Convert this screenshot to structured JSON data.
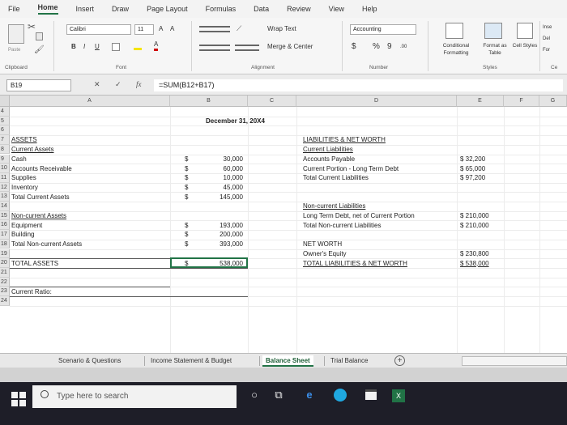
{
  "menu": {
    "tabs": [
      "File",
      "Home",
      "Insert",
      "Draw",
      "Page Layout",
      "Formulas",
      "Data",
      "Review",
      "View",
      "Help"
    ],
    "active_index": 1
  },
  "ribbon": {
    "font_name": "Calibri",
    "font_size": "11",
    "paste_label": "Paste",
    "bold": "B",
    "italic": "I",
    "underline": "U",
    "wrap_text": "Wrap Text",
    "merge_center": "Merge & Center",
    "number_format": "Accounting",
    "currency_symbol": "$",
    "percent_symbol": "%",
    "comma_symbol": "9",
    "conditional_formatting": "Conditional Formatting",
    "format_as_table": "Format as Table",
    "cell_styles": "Cell Styles",
    "insert": "Inse",
    "delete": "Del",
    "format": "For",
    "groups": {
      "clipboard": "Clipboard",
      "font": "Font",
      "alignment": "Alignment",
      "number": "Number",
      "styles": "Styles",
      "cells": "Ce"
    }
  },
  "formula_bar": {
    "name_box": "B19",
    "formula": "=SUM(B12+B17)"
  },
  "columns": [
    "A",
    "B",
    "C",
    "D",
    "E",
    "F",
    "G"
  ],
  "rows": [
    "4",
    "5",
    "6",
    "7",
    "8",
    "9",
    "10",
    "11",
    "12",
    "13",
    "14",
    "15",
    "16",
    "17",
    "18",
    "19",
    "20",
    "21",
    "22",
    "23",
    "24"
  ],
  "sheet": {
    "date_header": "December 31, 20X4",
    "assets": {
      "title": "ASSETS",
      "current_assets": "Current Assets",
      "cash": "Cash",
      "accounts_receivable": "Accounts Receivable",
      "supplies": "Supplies",
      "inventory": "Inventory",
      "total_current_assets": "Total Current Assets",
      "noncurrent_assets": "Non-current Assets",
      "equipment": "Equipment",
      "building": "Building",
      "total_noncurrent_assets": "Total Non-current Assets",
      "total_assets": "TOTAL ASSETS",
      "current_ratio": "Current Ratio:"
    },
    "dollar": "$",
    "values": {
      "cash": "30,000",
      "accounts_receivable": "60,000",
      "supplies": "10,000",
      "inventory": "45,000",
      "total_current_assets": "145,000",
      "equipment": "193,000",
      "building": "200,000",
      "total_noncurrent_assets": "393,000",
      "total_assets": "538,000"
    },
    "liabilities": {
      "title": "LIABILITIES & NET WORTH",
      "current_liabilities": "Current Liabilities",
      "accounts_payable": "Accounts Payable",
      "current_portion_ltd": "Current Portion - Long Term Debt",
      "total_current_liabilities": "Total Current Liabilities",
      "noncurrent_liabilities": "Non-current Liabilities",
      "ltd_net": "Long Term Debt, net of Current Portion",
      "total_noncurrent_liabilities": "Total Non-current Liabilities",
      "net_worth": "NET WORTH",
      "owners_equity": "Owner's Equity",
      "total_liabilities_net_worth": "TOTAL LIABILITIES & NET WORTH"
    },
    "liability_values": {
      "accounts_payable": "$ 32,200",
      "current_portion_ltd": "$ 65,000",
      "total_current_liabilities": "$ 97,200",
      "ltd_net": "$ 210,000",
      "total_noncurrent_liabilities": "$ 210,000",
      "owners_equity": "$ 230,800",
      "total_liabilities_net_worth": "$ 538,000"
    }
  },
  "sheet_tabs": [
    "Scenario & Questions",
    "Income Statement & Budget",
    "Balance Sheet",
    "Trial Balance"
  ],
  "active_sheet": "Balance Sheet",
  "taskbar": {
    "search_placeholder": "Type here to search"
  },
  "colors": {
    "accent": "#217346",
    "taskbar": "#1e1e28"
  }
}
